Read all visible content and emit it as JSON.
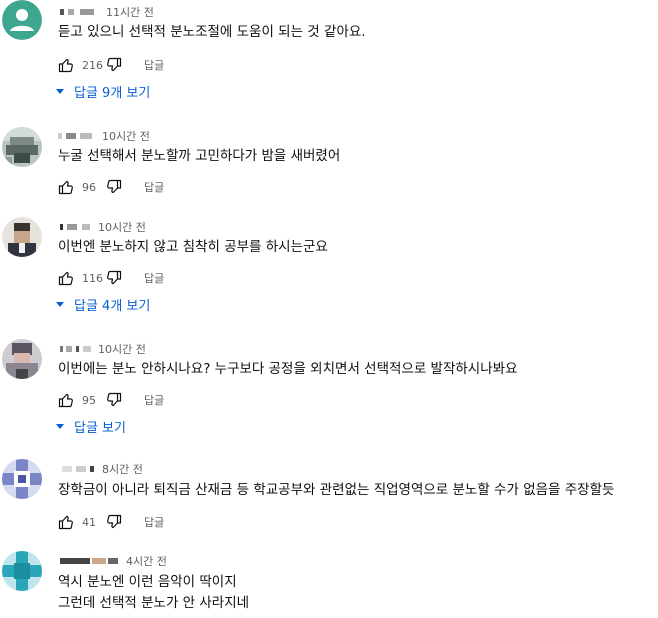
{
  "comments": [
    {
      "avatar": "default-person-icon",
      "time": "11시간 전",
      "lines": [
        "듣고 있으니 선택적 분노조절에 도움이 되는 것 같아요."
      ],
      "likes": "216",
      "reply_label": "답글",
      "replies_toggle": "답글 9개 보기"
    },
    {
      "avatar": "user-avatar",
      "time": "10시간 전",
      "lines": [
        "누굴 선택해서 분노할까 고민하다가 밤을 새버렸어"
      ],
      "likes": "96",
      "reply_label": "답글"
    },
    {
      "avatar": "user-avatar",
      "time": "10시간 전",
      "lines": [
        "이번엔 분노하지 않고 침착히 공부를 하시는군요"
      ],
      "likes": "116",
      "reply_label": "답글",
      "replies_toggle": "답글 4개 보기"
    },
    {
      "avatar": "user-avatar",
      "time": "10시간 전",
      "lines": [
        "이번에는 분노 안하시나요? 누구보다 공정을 외치면서 선택적으로 발작하시나봐요"
      ],
      "likes": "95",
      "reply_label": "답글",
      "replies_toggle": "답글 보기"
    },
    {
      "avatar": "user-avatar",
      "time": "8시간 전",
      "lines": [
        "장학금이 아니라 퇴직금 산재금 등 학교공부와 관련없는 직업영역으로 분노할 수가 없음을 주장할듯"
      ],
      "likes": "41",
      "reply_label": "답글"
    },
    {
      "avatar": "user-avatar",
      "time": "4시간 전",
      "lines": [
        "역시 분노엔 이런 음악이 딱이지",
        "그런데 선택적 분노가 안 사라지네"
      ]
    }
  ],
  "colors": {
    "link": "#065fd4",
    "meta": "#606060",
    "text": "#0f0f0f"
  }
}
